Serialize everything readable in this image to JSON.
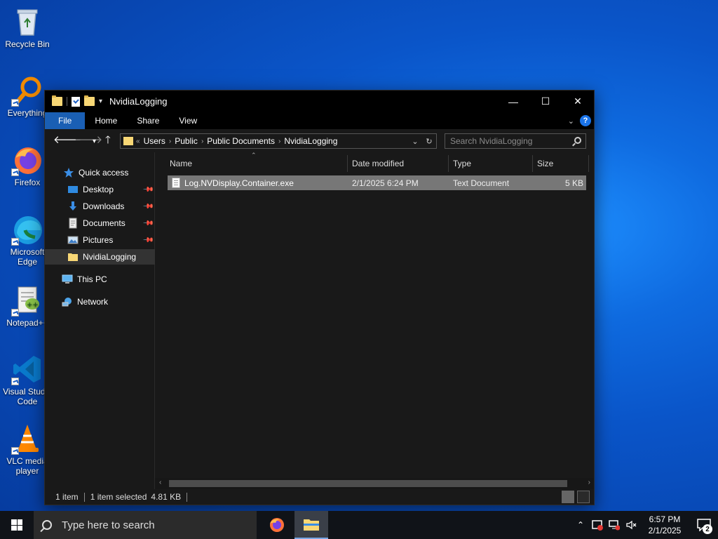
{
  "desktop": {
    "icons": [
      {
        "label": "Recycle Bin",
        "icon": "recycle-bin-icon"
      },
      {
        "label": "Everything",
        "icon": "everything-search-icon"
      },
      {
        "label": "Firefox",
        "icon": "firefox-icon"
      },
      {
        "label": "Microsoft Edge",
        "icon": "edge-icon"
      },
      {
        "label": "Notepad++",
        "icon": "notepad-plus-plus-icon"
      },
      {
        "label": "Visual Studio Code",
        "icon": "vscode-icon"
      },
      {
        "label": "VLC media player",
        "icon": "vlc-icon"
      }
    ]
  },
  "window": {
    "title": "NvidiaLogging",
    "controls": {
      "minimize": "—",
      "maximize": "☐",
      "close": "✕"
    },
    "ribbon_tabs": [
      "File",
      "Home",
      "Share",
      "View"
    ],
    "address": {
      "overflow": "«",
      "crumbs": [
        "Users",
        "Public",
        "Public Documents",
        "NvidiaLogging"
      ]
    },
    "search": {
      "placeholder": "Search NvidiaLogging"
    },
    "navpane": {
      "quick_access": "Quick access",
      "items": [
        "Desktop",
        "Downloads",
        "Documents",
        "Pictures",
        "NvidiaLogging"
      ],
      "this_pc": "This PC",
      "network": "Network"
    },
    "columns": [
      "Name",
      "Date modified",
      "Type",
      "Size"
    ],
    "files": [
      {
        "name": "Log.NVDisplay.Container.exe",
        "date": "2/1/2025 6:24 PM",
        "type": "Text Document",
        "size": "5 KB"
      }
    ],
    "status": {
      "count": "1 item",
      "selected": "1 item selected",
      "size": "4.81 KB"
    }
  },
  "taskbar": {
    "search_placeholder": "Type here to search",
    "time": "6:57 PM",
    "date": "2/1/2025",
    "notifications": "2"
  },
  "colors": {
    "accent": "#1a5fb4",
    "selection": "#777777",
    "folder": "#f8d775"
  }
}
